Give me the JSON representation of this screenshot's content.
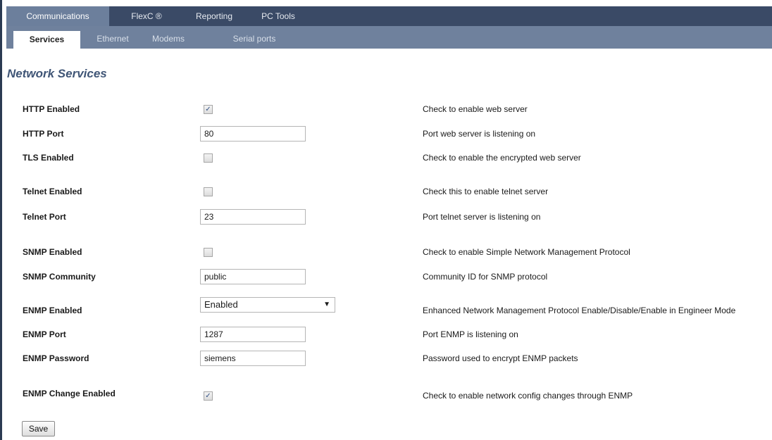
{
  "top_nav": {
    "tabs": [
      {
        "label": "Communications",
        "active": true
      },
      {
        "label": "FlexC ®",
        "active": false
      },
      {
        "label": "Reporting",
        "active": false
      },
      {
        "label": "PC Tools",
        "active": false
      }
    ]
  },
  "sub_nav": {
    "tabs": [
      {
        "label": "Services",
        "active": true
      },
      {
        "label": "Ethernet",
        "active": false
      },
      {
        "label": "Modems",
        "active": false
      },
      {
        "label": "Serial ports",
        "active": false
      }
    ]
  },
  "page": {
    "title": "Network Services"
  },
  "settings": {
    "http_enabled": {
      "label": "HTTP Enabled",
      "checked": true,
      "description": "Check to enable web server"
    },
    "http_port": {
      "label": "HTTP Port",
      "value": "80",
      "description": "Port web server is listening on"
    },
    "tls_enabled": {
      "label": "TLS Enabled",
      "checked": false,
      "description": "Check to enable the encrypted web server"
    },
    "telnet_enabled": {
      "label": "Telnet Enabled",
      "checked": false,
      "description": "Check this to enable telnet server"
    },
    "telnet_port": {
      "label": "Telnet Port",
      "value": "23",
      "description": "Port telnet server is listening on"
    },
    "snmp_enabled": {
      "label": "SNMP Enabled",
      "checked": false,
      "description": "Check to enable Simple Network Management Protocol"
    },
    "snmp_community": {
      "label": "SNMP Community",
      "value": "public",
      "description": "Community ID for SNMP protocol"
    },
    "enmp_enabled": {
      "label": "ENMP Enabled",
      "selected": "Enabled",
      "description": "Enhanced Network Management Protocol Enable/Disable/Enable in Engineer Mode"
    },
    "enmp_port": {
      "label": "ENMP Port",
      "value": "1287",
      "description": "Port ENMP is listening on"
    },
    "enmp_password": {
      "label": "ENMP Password",
      "value": "siemens",
      "description": "Password used to encrypt ENMP packets"
    },
    "enmp_change_enabled": {
      "label": "ENMP Change Enabled",
      "checked": true,
      "description": "Check to enable network config changes through ENMP"
    }
  },
  "actions": {
    "save_label": "Save"
  },
  "icons": {
    "checkmark": "✓",
    "dropdown_arrow": "▼"
  }
}
